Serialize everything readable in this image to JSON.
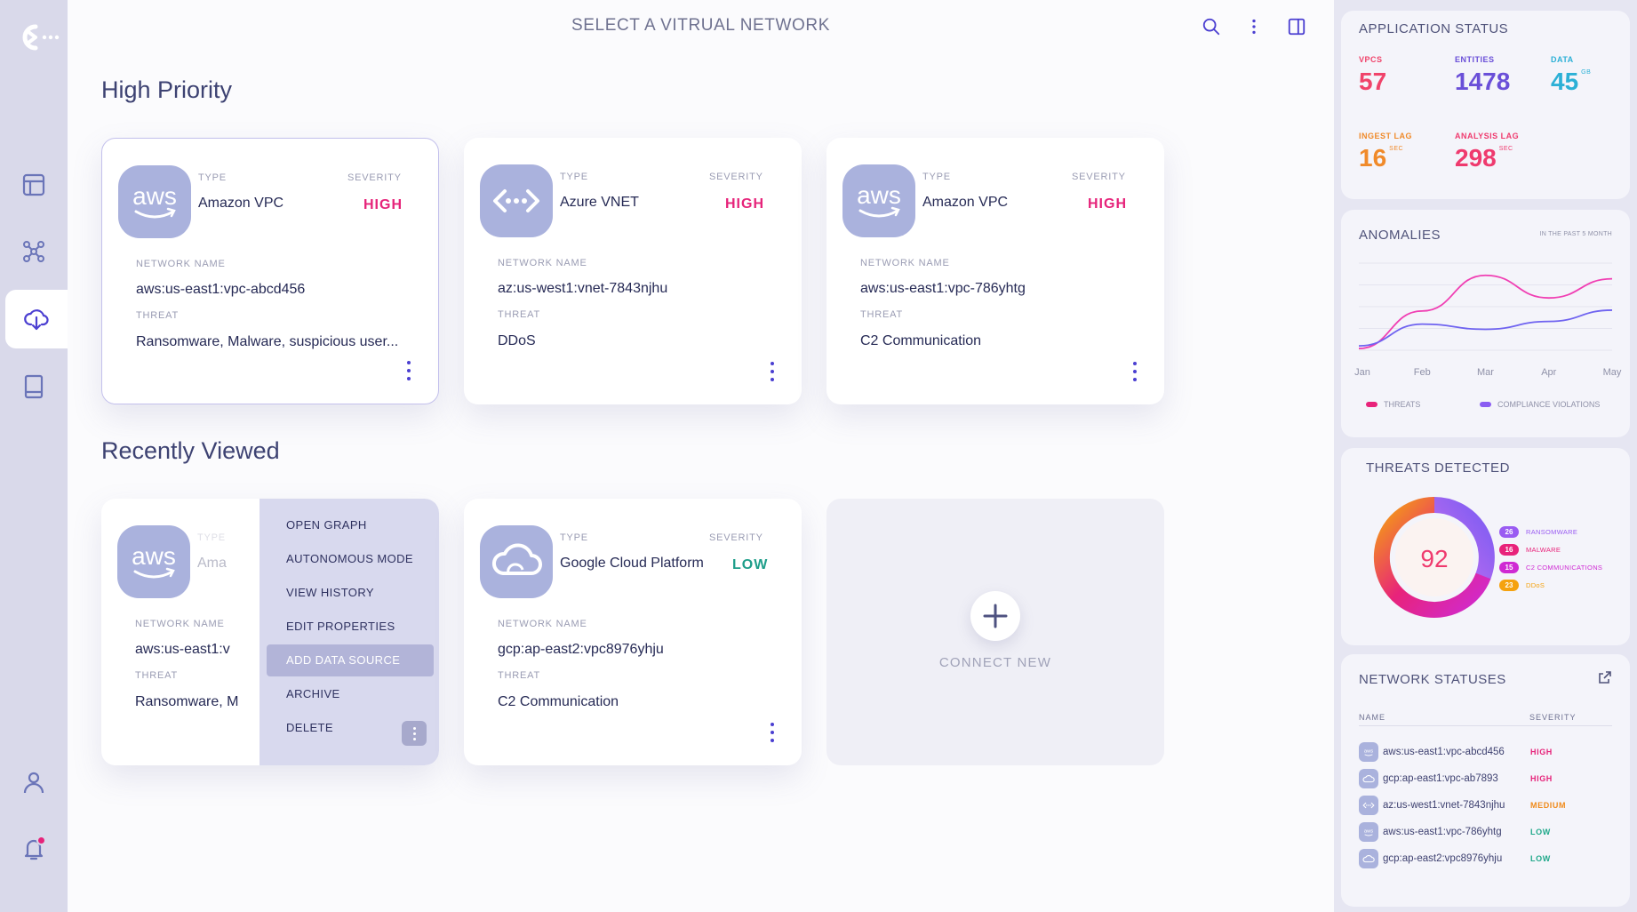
{
  "header": {
    "title": "SELECT A VITRUAL NETWORK"
  },
  "sections": {
    "high_priority": "High Priority",
    "recently_viewed": "Recently Viewed"
  },
  "labels": {
    "type": "TYPE",
    "severity": "SEVERITY",
    "network_name": "NETWORK NAME",
    "threat": "THREAT"
  },
  "high_priority_cards": [
    {
      "logo": "aws-logo",
      "type": "Amazon VPC",
      "severity": "HIGH",
      "network_name": "aws:us-east1:vpc-abcd456",
      "threat": "Ransomware, Malware, suspicious user..."
    },
    {
      "logo": "azure-vnet-logo",
      "type": "Azure VNET",
      "severity": "HIGH",
      "network_name": "az:us-west1:vnet-7843njhu",
      "threat": "DDoS"
    },
    {
      "logo": "aws-logo",
      "type": "Amazon VPC",
      "severity": "HIGH",
      "network_name": "aws:us-east1:vpc-786yhtg",
      "threat": "C2 Communication"
    }
  ],
  "recent_cards": [
    {
      "logo": "aws-logo",
      "type": "Ama",
      "severity": "",
      "network_name": "aws:us-east1:v",
      "threat": "Ransomware, M"
    },
    {
      "logo": "gcp-logo",
      "type": "Google Cloud Platform",
      "severity": "LOW",
      "network_name": "gcp:ap-east2:vpc8976yhju",
      "threat": "C2 Communication"
    }
  ],
  "context_menu": {
    "items": [
      "OPEN GRAPH",
      "AUTONOMOUS MODE",
      "VIEW HISTORY",
      "EDIT PROPERTIES",
      "ADD DATA SOURCE",
      "ARCHIVE",
      "DELETE"
    ],
    "highlighted": "ADD DATA SOURCE"
  },
  "connect_new": {
    "label": "CONNECT NEW"
  },
  "app_status": {
    "title": "APPLICATION STATUS",
    "stats": [
      {
        "label": "VPCS",
        "value": "57",
        "unit": "",
        "color": "#f0436a"
      },
      {
        "label": "ENTITIES",
        "value": "1478",
        "unit": "",
        "color": "#6a4fd8"
      },
      {
        "label": "DATA",
        "value": "45",
        "unit": "GB",
        "color": "#2cb0d6"
      },
      {
        "label": "INGEST LAG",
        "value": "16",
        "unit": "SEC",
        "color": "#f08a2a"
      },
      {
        "label": "ANALYSIS LAG",
        "value": "298",
        "unit": "SEC",
        "color": "#ef3a6e"
      }
    ]
  },
  "anomalies": {
    "title": "ANOMALIES",
    "note": "IN THE PAST 5 MONTH",
    "legend": [
      "THREATS",
      "COMPLIANCE VIOLATIONS"
    ]
  },
  "chart_data": {
    "type": "line",
    "title": "ANOMALIES",
    "x": [
      "Jan",
      "Feb",
      "Mar",
      "Apr",
      "May"
    ],
    "ylim": [
      0,
      100
    ],
    "series": [
      {
        "name": "THREATS",
        "color": "#f03fb3",
        "values": [
          2,
          45,
          86,
          60,
          82
        ]
      },
      {
        "name": "COMPLIANCE VIOLATIONS",
        "color": "#6f63f0",
        "values": [
          5,
          30,
          24,
          33,
          46
        ]
      }
    ]
  },
  "threats_detected": {
    "title": "THREATS DETECTED",
    "total": "92",
    "items": [
      {
        "count": "26",
        "name": "RANSOMWARE",
        "color": "#9a5cf2"
      },
      {
        "count": "16",
        "name": "MALWARE",
        "color": "#e8237a"
      },
      {
        "count": "15",
        "name": "C2 COMMUNICATIONS",
        "color": "#cf2ad3"
      },
      {
        "count": "23",
        "name": "DDoS",
        "color": "#f5a20f"
      }
    ]
  },
  "network_statuses": {
    "title": "NETWORK STATUSES",
    "columns": [
      "NAME",
      "SEVERITY"
    ],
    "rows": [
      {
        "icon": "aws-logo",
        "name": "aws:us-east1:vpc-abcd456",
        "severity": "HIGH",
        "color": "#e6237a"
      },
      {
        "icon": "gcp-logo",
        "name": "gcp:ap-east1:vpc-ab7893",
        "severity": "HIGH",
        "color": "#e6237a"
      },
      {
        "icon": "azure-vnet-logo",
        "name": "az:us-west1:vnet-7843njhu",
        "severity": "MEDIUM",
        "color": "#f08a1a"
      },
      {
        "icon": "aws-logo",
        "name": "aws:us-east1:vpc-786yhtg",
        "severity": "LOW",
        "color": "#1fa88a"
      },
      {
        "icon": "gcp-logo",
        "name": "gcp:ap-east2:vpc8976yhju",
        "severity": "LOW",
        "color": "#1fa88a"
      }
    ]
  },
  "colors": {
    "high": "#e6237a",
    "low": "#1e9e8a",
    "accent": "#4b3fd1"
  }
}
